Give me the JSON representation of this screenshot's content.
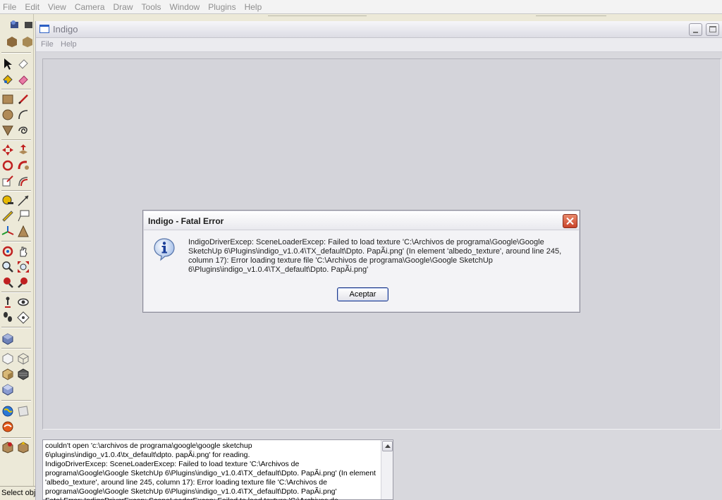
{
  "host": {
    "menu": [
      "File",
      "Edit",
      "View",
      "Camera",
      "Draw",
      "Tools",
      "Window",
      "Plugins",
      "Help"
    ],
    "status_text": "Select obje"
  },
  "indigo": {
    "title": "Indigo",
    "menu": {
      "file": "File",
      "help": "Help"
    },
    "log_text": "couldn't open 'c:\\archivos de programa\\google\\google sketchup 6\\plugins\\indigo_v1.0.4\\tx_default\\dpto. papÃi.png' for reading.\nIndigoDriverExcep: SceneLoaderExcep: Failed to load texture 'C:\\Archivos de programa\\Google\\Google SketchUp 6\\Plugins\\indigo_v1.0.4\\TX_default\\Dpto. PapÃi.png' (In element 'albedo_texture', around line 245, column 17): Error loading texture file 'C:\\Archivos de programa\\Google\\Google SketchUp 6\\Plugins\\indigo_v1.0.4\\TX_default\\Dpto. PapÃi.png'\nFatal Error: IndigoDriverExcep: SceneLoaderExcep: Failed to load texture 'C:\\Archivos de"
  },
  "dialog": {
    "title": "Indigo - Fatal Error",
    "message": "IndigoDriverExcep: SceneLoaderExcep: Failed to load texture 'C:\\Archivos de programa\\Google\\Google SketchUp 6\\Plugins\\indigo_v1.0.4\\TX_default\\Dpto. PapÃi.png' (In element 'albedo_texture', around line 245, column 17): Error loading texture file 'C:\\Archivos de programa\\Google\\Google SketchUp 6\\Plugins\\indigo_v1.0.4\\TX_default\\Dpto. PapÃi.png'",
    "ok_label": "Aceptar",
    "icon": "info-icon"
  },
  "colors": {
    "dialog_border": "#8b8b98",
    "close_button": "#c9432a",
    "ok_border": "#1f3a8a",
    "window_bg": "#d8d8dd"
  },
  "icons": [
    "select-icon",
    "eraser-icon",
    "paint-bucket-icon",
    "erase-tool-icon",
    "rectangle-icon",
    "pencil-icon",
    "circle-icon",
    "arc-icon",
    "polygon-icon",
    "freehand-icon",
    "move-icon",
    "push-pull-icon",
    "rotate-icon",
    "follow-me-icon",
    "scale-icon",
    "offset-icon",
    "tape-measure-icon",
    "dimension-icon",
    "protractor-icon",
    "text-icon",
    "axes-icon",
    "3d-text-icon",
    "orbit-icon",
    "pan-icon",
    "zoom-icon",
    "zoom-extents-icon",
    "previous-view-icon",
    "next-view-icon",
    "position-camera-icon",
    "look-around-icon",
    "walk-icon",
    "section-plane-icon",
    "iso-view-icon",
    "xray-icon",
    "wireframe-icon",
    "shaded-icon",
    "textured-icon",
    "cube-icon",
    "globe-icon",
    "photo-icon",
    "render-icon",
    "component-icon",
    "plugin-icon"
  ]
}
